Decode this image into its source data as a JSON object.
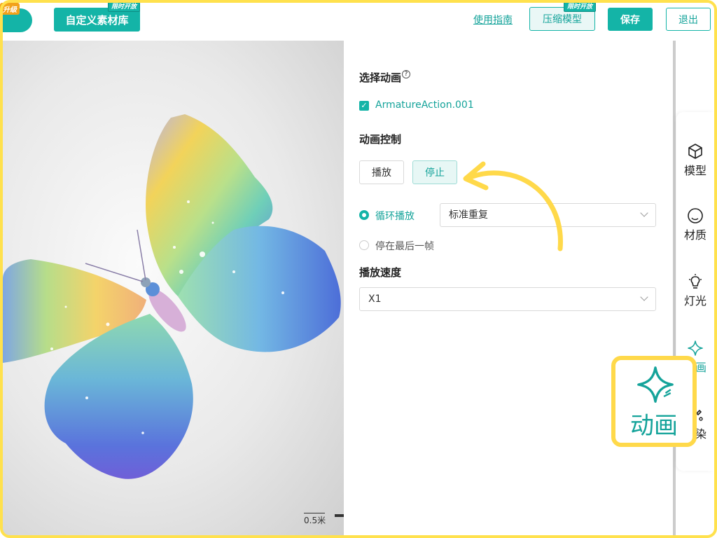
{
  "topbar": {
    "logo_ribbon": "升级",
    "material_button": "自定义素材库",
    "material_badge": "限时开放",
    "guide_link": "使用指南",
    "compress_button": "压缩模型",
    "compress_badge": "限时开放",
    "save_button": "保存",
    "exit_button": "退出"
  },
  "viewport": {
    "scale_label": "0.5米"
  },
  "panel": {
    "select_animation_title": "选择动画",
    "help_glyph": "?",
    "animation_item": "ArmatureAction.001",
    "animation_checked": true,
    "control_title": "动画控制",
    "play_button": "播放",
    "stop_button": "停止",
    "loop_option": "循环播放",
    "loop_mode": "标准重复",
    "stop_last_option": "停在最后一帧",
    "speed_title": "播放速度",
    "speed_value": "X1"
  },
  "tools": [
    {
      "label": "模型",
      "icon": "cube-icon"
    },
    {
      "label": "材质",
      "icon": "sphere-icon"
    },
    {
      "label": "灯光",
      "icon": "bulb-icon"
    },
    {
      "label": "动画",
      "icon": "sparkle-icon",
      "active": true
    },
    {
      "label": "渲染",
      "icon": "brush-icon"
    }
  ],
  "callout": {
    "label": "动画",
    "icon": "sparkle-icon"
  },
  "colors": {
    "accent": "#14B4A7",
    "highlight": "#FFD94A"
  }
}
